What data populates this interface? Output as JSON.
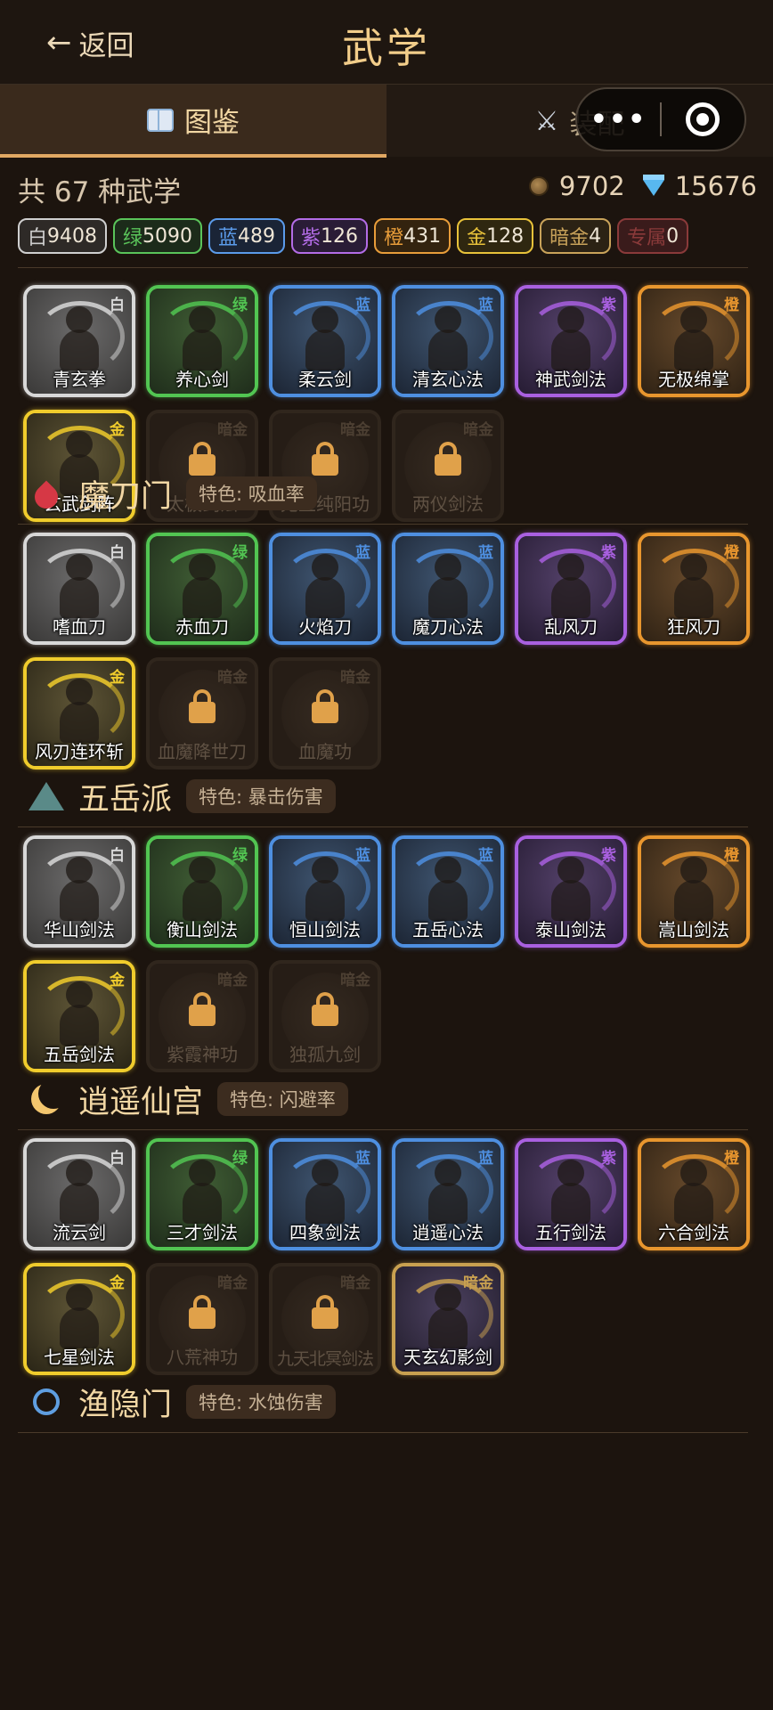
{
  "header": {
    "back_label": "返回",
    "title": "武学"
  },
  "tabs": [
    {
      "label": "图鉴",
      "icon": "book-icon",
      "active": true
    },
    {
      "label": "装配",
      "icon": "swords-icon",
      "active": false
    }
  ],
  "capsule": {
    "more": "•••",
    "icon": "target-icon"
  },
  "summary": {
    "total": "共 67 种武学",
    "coins": "9702",
    "gems": "15676"
  },
  "counts": [
    {
      "label": "白",
      "value": "9408",
      "color": "#cfcfcf",
      "bg": "#2e2a27"
    },
    {
      "label": "绿",
      "value": "5090",
      "color": "#5ac45a",
      "bg": "#1c2b1a"
    },
    {
      "label": "蓝",
      "value": "489",
      "color": "#5b9bea",
      "bg": "#1a2436"
    },
    {
      "label": "紫",
      "value": "126",
      "color": "#b36ce6",
      "bg": "#2a1c36"
    },
    {
      "label": "橙",
      "value": "431",
      "color": "#e89d3a",
      "bg": "#33230f"
    },
    {
      "label": "金",
      "value": "128",
      "color": "#e8c23a",
      "bg": "#2f2710"
    },
    {
      "label": "暗金",
      "value": "4",
      "color": "#c9a35a",
      "bg": "#2b2214"
    },
    {
      "label": "专属",
      "value": "0",
      "color": "#8a3a3a",
      "bg": "#3a1b1b"
    }
  ],
  "rarity_colors": {
    "白": "#d8d8d8",
    "绿": "#52c552",
    "蓝": "#4e8fe0",
    "紫": "#a960e0",
    "橙": "#e8962e",
    "金": "#f0cc2c",
    "暗金": "#c8a050"
  },
  "sections": [
    {
      "name": "",
      "tag": "",
      "items": [
        {
          "name": "青玄拳",
          "rarity": "白",
          "locked": false
        },
        {
          "name": "养心剑",
          "rarity": "绿",
          "locked": false
        },
        {
          "name": "柔云剑",
          "rarity": "蓝",
          "locked": false
        },
        {
          "name": "清玄心法",
          "rarity": "蓝",
          "locked": false
        },
        {
          "name": "神武剑法",
          "rarity": "紫",
          "locked": false
        },
        {
          "name": "无极绵掌",
          "rarity": "橙",
          "locked": false
        },
        {
          "name": "玄武剑阵",
          "rarity": "金",
          "locked": false
        },
        {
          "name": "太极剑法",
          "rarity": "暗金",
          "locked": true
        },
        {
          "name": "无上纯阳功",
          "rarity": "暗金",
          "locked": true
        },
        {
          "name": "两仪剑法",
          "rarity": "暗金",
          "locked": true
        }
      ]
    },
    {
      "name": "魔刀门",
      "tag": "特色: 吸血率",
      "icon": "blood-drop-icon",
      "items": [
        {
          "name": "嗜血刀",
          "rarity": "白",
          "locked": false
        },
        {
          "name": "赤血刀",
          "rarity": "绿",
          "locked": false
        },
        {
          "name": "火焰刀",
          "rarity": "蓝",
          "locked": false
        },
        {
          "name": "魔刀心法",
          "rarity": "蓝",
          "locked": false
        },
        {
          "name": "乱风刀",
          "rarity": "紫",
          "locked": false
        },
        {
          "name": "狂风刀",
          "rarity": "橙",
          "locked": false
        },
        {
          "name": "风刃连环斩",
          "rarity": "金",
          "locked": false
        },
        {
          "name": "血魔降世刀",
          "rarity": "暗金",
          "locked": true
        },
        {
          "name": "血魔功",
          "rarity": "暗金",
          "locked": true
        }
      ]
    },
    {
      "name": "五岳派",
      "tag": "特色: 暴击伤害",
      "icon": "mountain-icon",
      "items": [
        {
          "name": "华山剑法",
          "rarity": "白",
          "locked": false
        },
        {
          "name": "衡山剑法",
          "rarity": "绿",
          "locked": false
        },
        {
          "name": "恒山剑法",
          "rarity": "蓝",
          "locked": false
        },
        {
          "name": "五岳心法",
          "rarity": "蓝",
          "locked": false
        },
        {
          "name": "泰山剑法",
          "rarity": "紫",
          "locked": false
        },
        {
          "name": "嵩山剑法",
          "rarity": "橙",
          "locked": false
        },
        {
          "name": "五岳剑法",
          "rarity": "金",
          "locked": false
        },
        {
          "name": "紫霞神功",
          "rarity": "暗金",
          "locked": true
        },
        {
          "name": "独孤九剑",
          "rarity": "暗金",
          "locked": true
        }
      ]
    },
    {
      "name": "逍遥仙宫",
      "tag": "特色: 闪避率",
      "icon": "moon-icon",
      "items": [
        {
          "name": "流云剑",
          "rarity": "白",
          "locked": false
        },
        {
          "name": "三才剑法",
          "rarity": "绿",
          "locked": false
        },
        {
          "name": "四象剑法",
          "rarity": "蓝",
          "locked": false
        },
        {
          "name": "逍遥心法",
          "rarity": "蓝",
          "locked": false
        },
        {
          "name": "五行剑法",
          "rarity": "紫",
          "locked": false
        },
        {
          "name": "六合剑法",
          "rarity": "橙",
          "locked": false
        },
        {
          "name": "七星剑法",
          "rarity": "金",
          "locked": false
        },
        {
          "name": "八荒神功",
          "rarity": "暗金",
          "locked": true
        },
        {
          "name": "九天北冥剑法",
          "rarity": "暗金",
          "locked": true
        },
        {
          "name": "天玄幻影剑",
          "rarity": "暗金",
          "locked": false
        }
      ]
    },
    {
      "name": "渔隐门",
      "tag": "特色: 水蚀伤害",
      "icon": "ring-icon",
      "items": []
    }
  ]
}
